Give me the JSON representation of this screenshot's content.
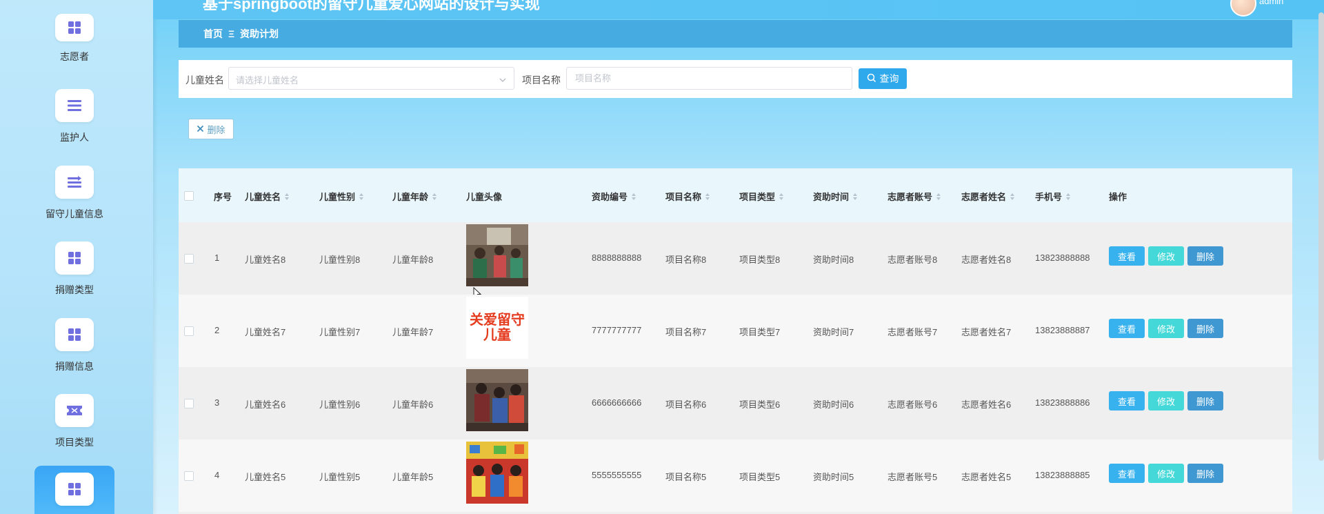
{
  "header": {
    "title": "基于springboot的留守儿童爱心网站的设计与实现",
    "user": "admin"
  },
  "sidebar": {
    "items": [
      {
        "label": "志愿者",
        "icon": "grid-icon"
      },
      {
        "label": "监护人",
        "icon": "list-icon"
      },
      {
        "label": "留守儿童信息",
        "icon": "transfer-icon"
      },
      {
        "label": "捐赠类型",
        "icon": "grid-icon"
      },
      {
        "label": "捐赠信息",
        "icon": "grid-icon"
      },
      {
        "label": "项目类型",
        "icon": "ticket-icon"
      },
      {
        "label": "",
        "icon": "grid-icon",
        "active": true
      }
    ]
  },
  "breadcrumb": {
    "home": "首页",
    "separator": "Ξ",
    "current": "资助计划"
  },
  "search": {
    "child_name_label": "儿童姓名",
    "child_name_placeholder": "请选择儿童姓名",
    "project_name_label": "项目名称",
    "project_name_placeholder": "项目名称",
    "button_label": "查询"
  },
  "actions": {
    "batch_delete_label": "删除"
  },
  "table": {
    "columns": [
      "序号",
      "儿童姓名",
      "儿童性别",
      "儿童年龄",
      "儿童头像",
      "资助编号",
      "项目名称",
      "项目类型",
      "资助时间",
      "志愿者账号",
      "志愿者姓名",
      "手机号",
      "操作"
    ],
    "rows": [
      {
        "index": "1",
        "child_name": "儿童姓名8",
        "child_gender": "儿童性别8",
        "child_age": "儿童年龄8",
        "sponsor_no": "8888888888",
        "project_name": "项目名称8",
        "project_type": "项目类型8",
        "sponsor_time": "资助时间8",
        "volunteer_account": "志愿者账号8",
        "volunteer_name": "志愿者姓名8",
        "phone": "13823888888"
      },
      {
        "index": "2",
        "child_name": "儿童姓名7",
        "child_gender": "儿童性别7",
        "child_age": "儿童年龄7",
        "sponsor_no": "7777777777",
        "project_name": "项目名称7",
        "project_type": "项目类型7",
        "sponsor_time": "资助时间7",
        "volunteer_account": "志愿者账号7",
        "volunteer_name": "志愿者姓名7",
        "phone": "13823888887"
      },
      {
        "index": "3",
        "child_name": "儿童姓名6",
        "child_gender": "儿童性别6",
        "child_age": "儿童年龄6",
        "sponsor_no": "6666666666",
        "project_name": "项目名称6",
        "project_type": "项目类型6",
        "sponsor_time": "资助时间6",
        "volunteer_account": "志愿者账号6",
        "volunteer_name": "志愿者姓名6",
        "phone": "13823888886"
      },
      {
        "index": "4",
        "child_name": "儿童姓名5",
        "child_gender": "儿童性别5",
        "child_age": "儿童年龄5",
        "sponsor_no": "5555555555",
        "project_name": "项目名称5",
        "project_type": "项目类型5",
        "sponsor_time": "资助时间5",
        "volunteer_account": "志愿者账号5",
        "volunteer_name": "志愿者姓名5",
        "phone": "13823888885"
      }
    ],
    "row_actions": {
      "view": "查看",
      "edit": "修改",
      "delete": "删除"
    },
    "image_2_text": "关爱留守儿童"
  },
  "colors": {
    "header": "#56c3f5",
    "breadcrumb": "#45abe0",
    "primary": "#2fa8ec",
    "view": "#38b2ef",
    "edit": "#45d8d8",
    "delete": "#3f98d1"
  }
}
